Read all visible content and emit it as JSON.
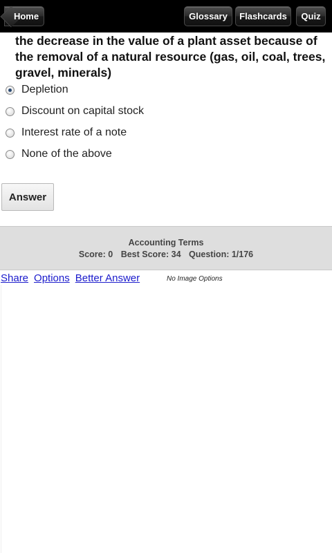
{
  "nav": {
    "home": "Home",
    "glossary": "Glossary",
    "flashcards": "Flashcards",
    "quiz": "Quiz"
  },
  "question": "the decrease in the value of a plant asset because of the removal of a natural resource (gas, oil, coal, trees, gravel, minerals)",
  "options": [
    {
      "label": "Depletion",
      "selected": true
    },
    {
      "label": "Discount on capital stock",
      "selected": false
    },
    {
      "label": "Interest rate of a note",
      "selected": false
    },
    {
      "label": "None of the above",
      "selected": false
    }
  ],
  "answer_label": "Answer",
  "footer": {
    "title": "Accounting Terms",
    "score": "Score: 0",
    "best_score": "Best Score: 34",
    "question_counter": "Question: 1/176"
  },
  "links": {
    "share": "Share",
    "options": "Options",
    "better_answer": "Better Answer",
    "no_image_options": "No Image Options"
  },
  "colors": {
    "topbar": "#000000",
    "link": "#1a1acc",
    "footer_bg": "#dedede"
  }
}
